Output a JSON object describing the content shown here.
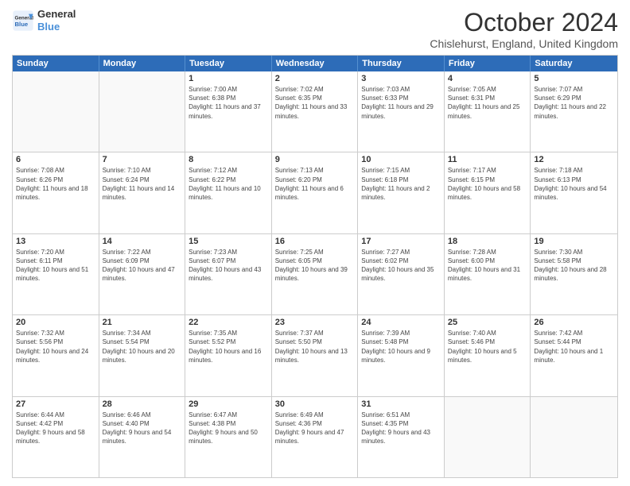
{
  "header": {
    "logo_line1": "General",
    "logo_line2": "Blue",
    "month_title": "October 2024",
    "location": "Chislehurst, England, United Kingdom"
  },
  "days": [
    "Sunday",
    "Monday",
    "Tuesday",
    "Wednesday",
    "Thursday",
    "Friday",
    "Saturday"
  ],
  "weeks": [
    [
      {
        "day": "",
        "sunrise": "",
        "sunset": "",
        "daylight": ""
      },
      {
        "day": "",
        "sunrise": "",
        "sunset": "",
        "daylight": ""
      },
      {
        "day": "1",
        "sunrise": "Sunrise: 7:00 AM",
        "sunset": "Sunset: 6:38 PM",
        "daylight": "Daylight: 11 hours and 37 minutes."
      },
      {
        "day": "2",
        "sunrise": "Sunrise: 7:02 AM",
        "sunset": "Sunset: 6:35 PM",
        "daylight": "Daylight: 11 hours and 33 minutes."
      },
      {
        "day": "3",
        "sunrise": "Sunrise: 7:03 AM",
        "sunset": "Sunset: 6:33 PM",
        "daylight": "Daylight: 11 hours and 29 minutes."
      },
      {
        "day": "4",
        "sunrise": "Sunrise: 7:05 AM",
        "sunset": "Sunset: 6:31 PM",
        "daylight": "Daylight: 11 hours and 25 minutes."
      },
      {
        "day": "5",
        "sunrise": "Sunrise: 7:07 AM",
        "sunset": "Sunset: 6:29 PM",
        "daylight": "Daylight: 11 hours and 22 minutes."
      }
    ],
    [
      {
        "day": "6",
        "sunrise": "Sunrise: 7:08 AM",
        "sunset": "Sunset: 6:26 PM",
        "daylight": "Daylight: 11 hours and 18 minutes."
      },
      {
        "day": "7",
        "sunrise": "Sunrise: 7:10 AM",
        "sunset": "Sunset: 6:24 PM",
        "daylight": "Daylight: 11 hours and 14 minutes."
      },
      {
        "day": "8",
        "sunrise": "Sunrise: 7:12 AM",
        "sunset": "Sunset: 6:22 PM",
        "daylight": "Daylight: 11 hours and 10 minutes."
      },
      {
        "day": "9",
        "sunrise": "Sunrise: 7:13 AM",
        "sunset": "Sunset: 6:20 PM",
        "daylight": "Daylight: 11 hours and 6 minutes."
      },
      {
        "day": "10",
        "sunrise": "Sunrise: 7:15 AM",
        "sunset": "Sunset: 6:18 PM",
        "daylight": "Daylight: 11 hours and 2 minutes."
      },
      {
        "day": "11",
        "sunrise": "Sunrise: 7:17 AM",
        "sunset": "Sunset: 6:15 PM",
        "daylight": "Daylight: 10 hours and 58 minutes."
      },
      {
        "day": "12",
        "sunrise": "Sunrise: 7:18 AM",
        "sunset": "Sunset: 6:13 PM",
        "daylight": "Daylight: 10 hours and 54 minutes."
      }
    ],
    [
      {
        "day": "13",
        "sunrise": "Sunrise: 7:20 AM",
        "sunset": "Sunset: 6:11 PM",
        "daylight": "Daylight: 10 hours and 51 minutes."
      },
      {
        "day": "14",
        "sunrise": "Sunrise: 7:22 AM",
        "sunset": "Sunset: 6:09 PM",
        "daylight": "Daylight: 10 hours and 47 minutes."
      },
      {
        "day": "15",
        "sunrise": "Sunrise: 7:23 AM",
        "sunset": "Sunset: 6:07 PM",
        "daylight": "Daylight: 10 hours and 43 minutes."
      },
      {
        "day": "16",
        "sunrise": "Sunrise: 7:25 AM",
        "sunset": "Sunset: 6:05 PM",
        "daylight": "Daylight: 10 hours and 39 minutes."
      },
      {
        "day": "17",
        "sunrise": "Sunrise: 7:27 AM",
        "sunset": "Sunset: 6:02 PM",
        "daylight": "Daylight: 10 hours and 35 minutes."
      },
      {
        "day": "18",
        "sunrise": "Sunrise: 7:28 AM",
        "sunset": "Sunset: 6:00 PM",
        "daylight": "Daylight: 10 hours and 31 minutes."
      },
      {
        "day": "19",
        "sunrise": "Sunrise: 7:30 AM",
        "sunset": "Sunset: 5:58 PM",
        "daylight": "Daylight: 10 hours and 28 minutes."
      }
    ],
    [
      {
        "day": "20",
        "sunrise": "Sunrise: 7:32 AM",
        "sunset": "Sunset: 5:56 PM",
        "daylight": "Daylight: 10 hours and 24 minutes."
      },
      {
        "day": "21",
        "sunrise": "Sunrise: 7:34 AM",
        "sunset": "Sunset: 5:54 PM",
        "daylight": "Daylight: 10 hours and 20 minutes."
      },
      {
        "day": "22",
        "sunrise": "Sunrise: 7:35 AM",
        "sunset": "Sunset: 5:52 PM",
        "daylight": "Daylight: 10 hours and 16 minutes."
      },
      {
        "day": "23",
        "sunrise": "Sunrise: 7:37 AM",
        "sunset": "Sunset: 5:50 PM",
        "daylight": "Daylight: 10 hours and 13 minutes."
      },
      {
        "day": "24",
        "sunrise": "Sunrise: 7:39 AM",
        "sunset": "Sunset: 5:48 PM",
        "daylight": "Daylight: 10 hours and 9 minutes."
      },
      {
        "day": "25",
        "sunrise": "Sunrise: 7:40 AM",
        "sunset": "Sunset: 5:46 PM",
        "daylight": "Daylight: 10 hours and 5 minutes."
      },
      {
        "day": "26",
        "sunrise": "Sunrise: 7:42 AM",
        "sunset": "Sunset: 5:44 PM",
        "daylight": "Daylight: 10 hours and 1 minute."
      }
    ],
    [
      {
        "day": "27",
        "sunrise": "Sunrise: 6:44 AM",
        "sunset": "Sunset: 4:42 PM",
        "daylight": "Daylight: 9 hours and 58 minutes."
      },
      {
        "day": "28",
        "sunrise": "Sunrise: 6:46 AM",
        "sunset": "Sunset: 4:40 PM",
        "daylight": "Daylight: 9 hours and 54 minutes."
      },
      {
        "day": "29",
        "sunrise": "Sunrise: 6:47 AM",
        "sunset": "Sunset: 4:38 PM",
        "daylight": "Daylight: 9 hours and 50 minutes."
      },
      {
        "day": "30",
        "sunrise": "Sunrise: 6:49 AM",
        "sunset": "Sunset: 4:36 PM",
        "daylight": "Daylight: 9 hours and 47 minutes."
      },
      {
        "day": "31",
        "sunrise": "Sunrise: 6:51 AM",
        "sunset": "Sunset: 4:35 PM",
        "daylight": "Daylight: 9 hours and 43 minutes."
      },
      {
        "day": "",
        "sunrise": "",
        "sunset": "",
        "daylight": ""
      },
      {
        "day": "",
        "sunrise": "",
        "sunset": "",
        "daylight": ""
      }
    ]
  ]
}
